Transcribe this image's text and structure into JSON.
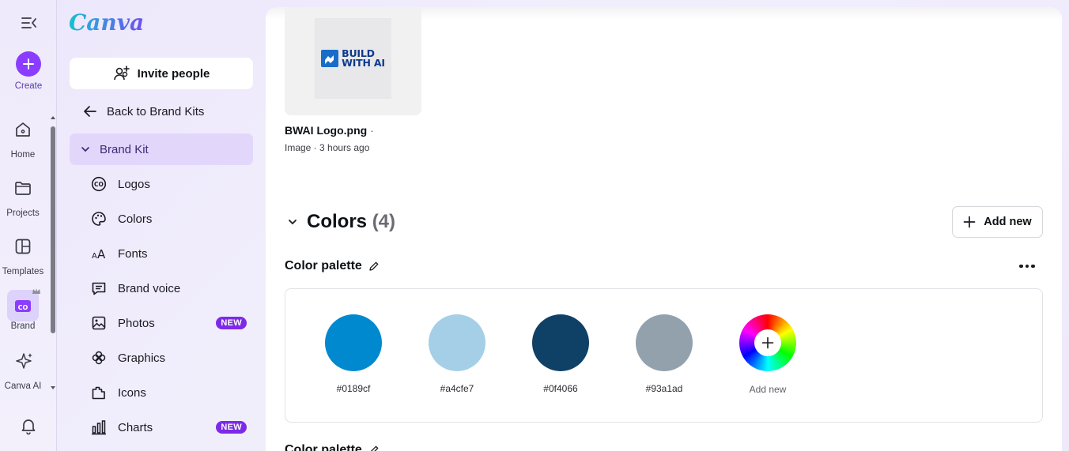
{
  "app": {
    "logo": "Canva"
  },
  "rail": {
    "create_label": "Create",
    "items": [
      {
        "label": "Home",
        "icon": "home-icon"
      },
      {
        "label": "Projects",
        "icon": "folder-icon"
      },
      {
        "label": "Templates",
        "icon": "templates-icon"
      },
      {
        "label": "Brand",
        "icon": "brand-icon"
      },
      {
        "label": "Canva AI",
        "icon": "sparkle-icon"
      }
    ]
  },
  "sidebar": {
    "invite_label": "Invite people",
    "back_label": "Back to Brand Kits",
    "kit_label": "Brand Kit",
    "items": [
      {
        "label": "Logos",
        "icon": "logo-icon"
      },
      {
        "label": "Colors",
        "icon": "palette-icon"
      },
      {
        "label": "Fonts",
        "icon": "fonts-icon"
      },
      {
        "label": "Brand voice",
        "icon": "brand-voice-icon"
      },
      {
        "label": "Photos",
        "icon": "photo-icon",
        "badge": "NEW"
      },
      {
        "label": "Graphics",
        "icon": "graphics-icon"
      },
      {
        "label": "Icons",
        "icon": "icons-icon"
      },
      {
        "label": "Charts",
        "icon": "chart-icon",
        "badge": "NEW"
      }
    ]
  },
  "main": {
    "asset": {
      "logo_text_line1": "BUILD",
      "logo_text_line2": "WITH AI",
      "name": "BWAI Logo.png",
      "name_suffix": " ·",
      "meta": "Image · 3 hours ago"
    },
    "colors_section": {
      "title": "Colors",
      "count": "(4)",
      "add_new_label": "Add new",
      "palette_title": "Color palette",
      "palette_title_2": "Color palette",
      "swatches": [
        {
          "hex": "#0189cf",
          "label": "#0189cf"
        },
        {
          "hex": "#a4cfe7",
          "label": "#a4cfe7"
        },
        {
          "hex": "#0f4066",
          "label": "#0f4066"
        },
        {
          "hex": "#93a1ad",
          "label": "#93a1ad"
        }
      ],
      "add_swatch_label": "Add new"
    }
  },
  "colors": {
    "accent": "#8b3dff",
    "badge": "#7d2ae8",
    "selected_bg": "#e2d7fb"
  }
}
